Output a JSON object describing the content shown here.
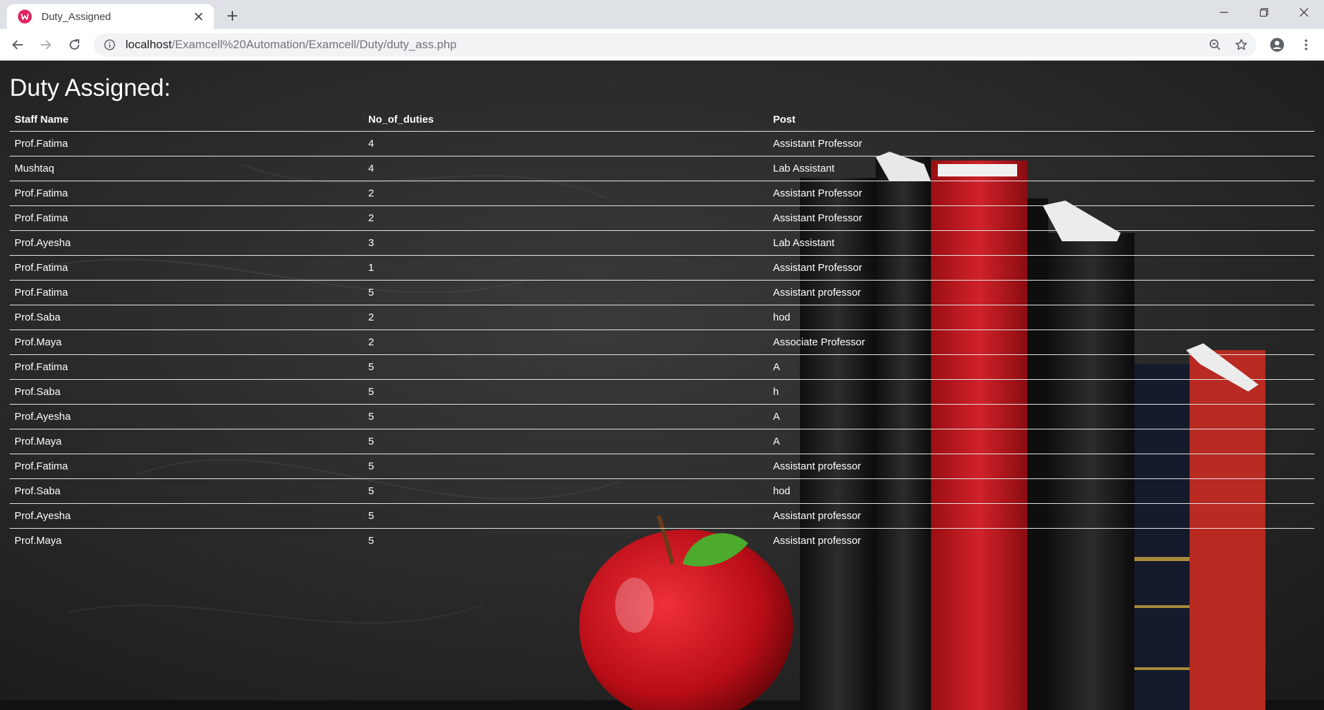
{
  "browser": {
    "tab_title": "Duty_Assigned",
    "url_host": "localhost",
    "url_path": "/Examcell%20Automation/Examcell/Duty/duty_ass.php"
  },
  "page": {
    "heading": "Duty Assigned:",
    "table": {
      "headers": [
        "Staff Name",
        "No_of_duties",
        "Post"
      ],
      "rows": [
        [
          "Prof.Fatima",
          "4",
          "Assistant Professor"
        ],
        [
          "Mushtaq",
          "4",
          "Lab Assistant"
        ],
        [
          "Prof.Fatima",
          "2",
          "Assistant Professor"
        ],
        [
          "Prof.Fatima",
          "2",
          "Assistant Professor"
        ],
        [
          "Prof.Ayesha",
          "3",
          "Lab Assistant"
        ],
        [
          "Prof.Fatima",
          "1",
          "Assistant Professor"
        ],
        [
          "Prof.Fatima",
          "5",
          "Assistant professor"
        ],
        [
          "Prof.Saba",
          "2",
          "hod"
        ],
        [
          "Prof.Maya",
          "2",
          "Associate Professor"
        ],
        [
          "Prof.Fatima",
          "5",
          "A"
        ],
        [
          "Prof.Saba",
          "5",
          "h"
        ],
        [
          "Prof.Ayesha",
          "5",
          "A"
        ],
        [
          "Prof.Maya",
          "5",
          "A"
        ],
        [
          "Prof.Fatima",
          "5",
          "Assistant professor"
        ],
        [
          "Prof.Saba",
          "5",
          "hod"
        ],
        [
          "Prof.Ayesha",
          "5",
          "Assistant professor"
        ],
        [
          "Prof.Maya",
          "5",
          "Assistant professor"
        ]
      ]
    }
  },
  "icons": {
    "favicon": "wamp-favicon-icon",
    "tab_close": "close-icon",
    "new_tab": "plus-icon",
    "back": "back-arrow-icon",
    "forward": "forward-arrow-icon",
    "reload": "reload-icon",
    "site_info": "info-icon",
    "zoom": "zoom-icon",
    "bookmark": "star-icon",
    "profile": "account-icon",
    "menu": "kebab-menu-icon"
  },
  "colors": {
    "tab_strip": "#dee1e6",
    "favicon": "#e0245e",
    "text_on_board": "#ffffff",
    "chalkboard": "#2a2a2a",
    "apple": "#c8101a",
    "book_red": "#c41a1e"
  }
}
